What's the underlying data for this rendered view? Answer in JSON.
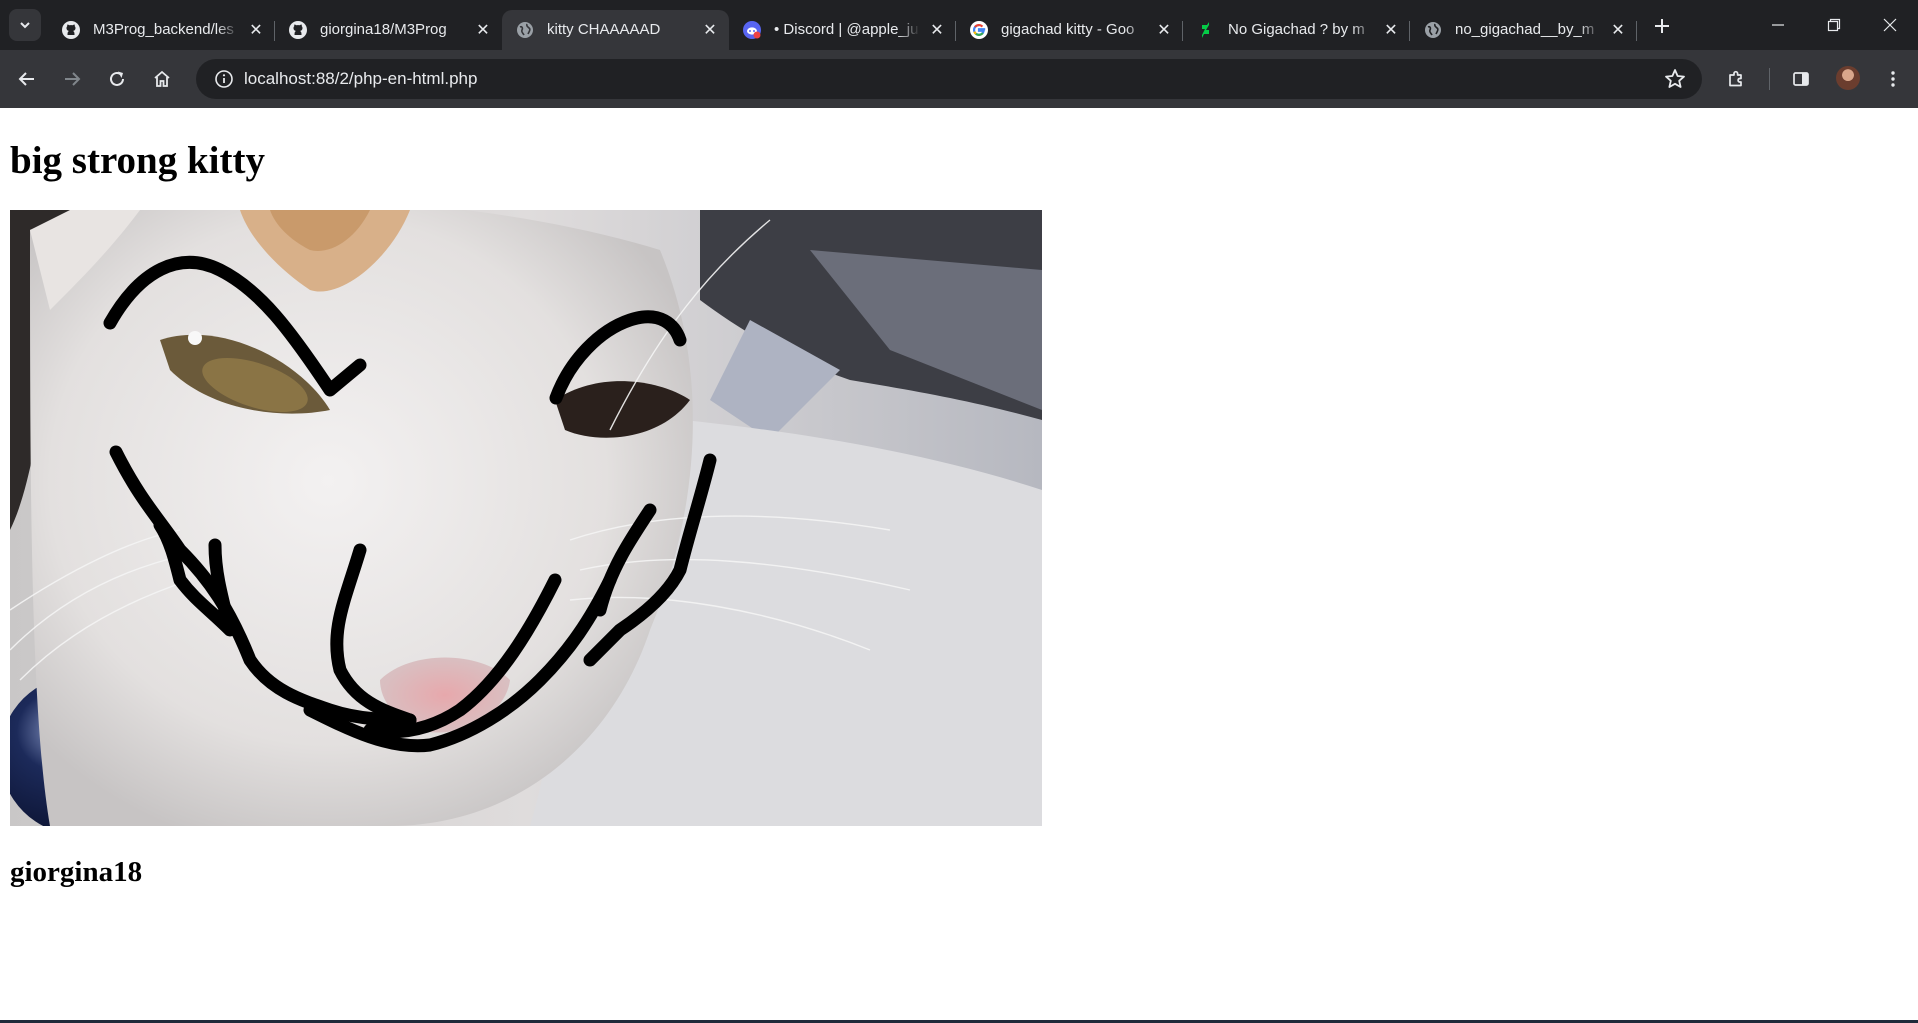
{
  "browser": {
    "tabs": [
      {
        "title": "M3Prog_backend/les",
        "favicon": "github-icon"
      },
      {
        "title": "giorgina18/M3Prog",
        "favicon": "github-icon"
      },
      {
        "title": "kitty CHAAAAAD",
        "favicon": "globe-icon",
        "active": true
      },
      {
        "title": "• Discord | @apple_ju",
        "favicon": "discord-icon"
      },
      {
        "title": "gigachad kitty - Goo",
        "favicon": "google-icon"
      },
      {
        "title": "No Gigachad ? by m",
        "favicon": "deviantart-icon"
      },
      {
        "title": "no_gigachad__by_m",
        "favicon": "globe-icon"
      }
    ],
    "url": "localhost:88/2/php-en-html.php"
  },
  "page": {
    "title": "big strong kitty",
    "author": "giorgina18"
  },
  "colors": {
    "tabstrip_bg": "#202124",
    "toolbar_bg": "#35363a",
    "omnibox_bg": "#202124"
  }
}
